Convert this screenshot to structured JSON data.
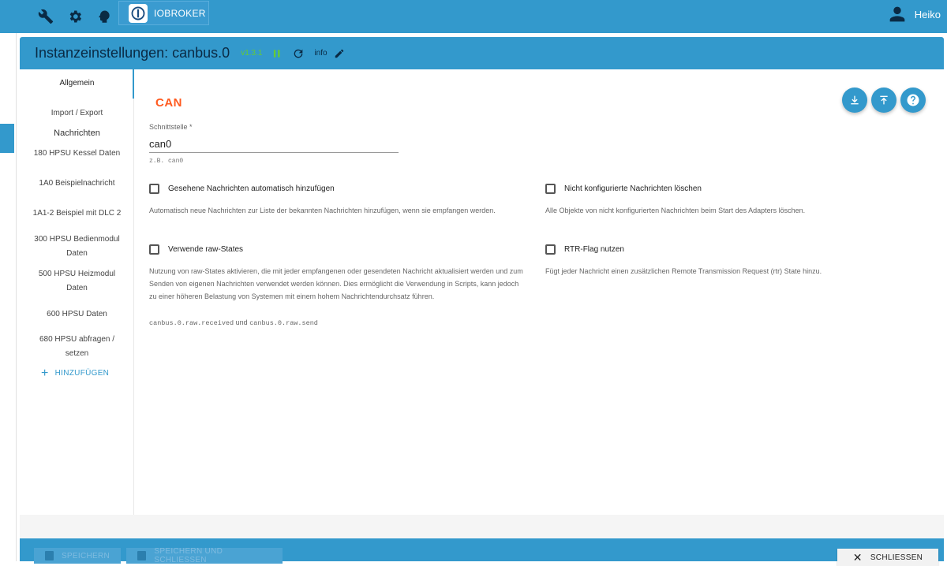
{
  "app": {
    "brand": "IOBROKER",
    "user": "Heiko"
  },
  "dialog": {
    "title": "Instanzeinstellungen: canbus.0",
    "version": "v1.3.1",
    "info_label": "info"
  },
  "sidebar": {
    "items": [
      {
        "label": "Allgemein"
      },
      {
        "label": "Import / Export"
      },
      {
        "label": "Nachrichten"
      },
      {
        "label": "180 HPSU Kessel Daten"
      },
      {
        "label": "1A0 Beispielnachricht"
      },
      {
        "label": "1A1-2 Beispiel mit DLC 2"
      },
      {
        "label": "300 HPSU Bedienmodul Daten"
      },
      {
        "label": "500 HPSU Heizmodul Daten"
      },
      {
        "label": "600 HPSU Daten"
      },
      {
        "label": "680 HPSU abfragen / setzen"
      }
    ],
    "add_label": "HINZUFÜGEN"
  },
  "main": {
    "logo_text": "CAN",
    "interface": {
      "label": "Schnittstelle *",
      "value": "can0",
      "hint": "z.B. can0"
    },
    "options": [
      {
        "label": "Gesehene Nachrichten automatisch hinzufügen",
        "description": "Automatisch neue Nachrichten zur Liste der bekannten Nachrichten hinzufügen, wenn sie empfangen werden.",
        "checked": false
      },
      {
        "label": "Nicht konfigurierte Nachrichten löschen",
        "description": "Alle Objekte von nicht konfigurierten Nachrichten beim Start des Adapters löschen.",
        "checked": false
      },
      {
        "label": "Verwende raw-States",
        "description": "Nutzung von raw-States aktivieren, die mit jeder empfangenen oder gesendeten Nachricht aktualisiert werden und zum Senden von eigenen Nachrichten verwendet werden können. Dies ermöglicht die Verwendung in Scripts, kann jedoch zu einer höheren Belastung von Systemen mit einem hohem Nachrichtendurchsatz führen.",
        "code1": "canbus.0.raw.received",
        "joiner": "und",
        "code2": "canbus.0.raw.send",
        "checked": false
      },
      {
        "label": "RTR-Flag nutzen",
        "description": "Fügt jeder Nachricht einen zusätzlichen Remote Transmission Request (rtr) State hinzu.",
        "checked": false
      }
    ]
  },
  "footer": {
    "save": "SPEICHERN",
    "save_close": "SPEICHERN UND SCHLIESSEN",
    "close": "SCHLIESSEN"
  },
  "colors": {
    "accent": "#3399cc",
    "version": "#66cc33",
    "can_logo": "#ff5a1f"
  }
}
